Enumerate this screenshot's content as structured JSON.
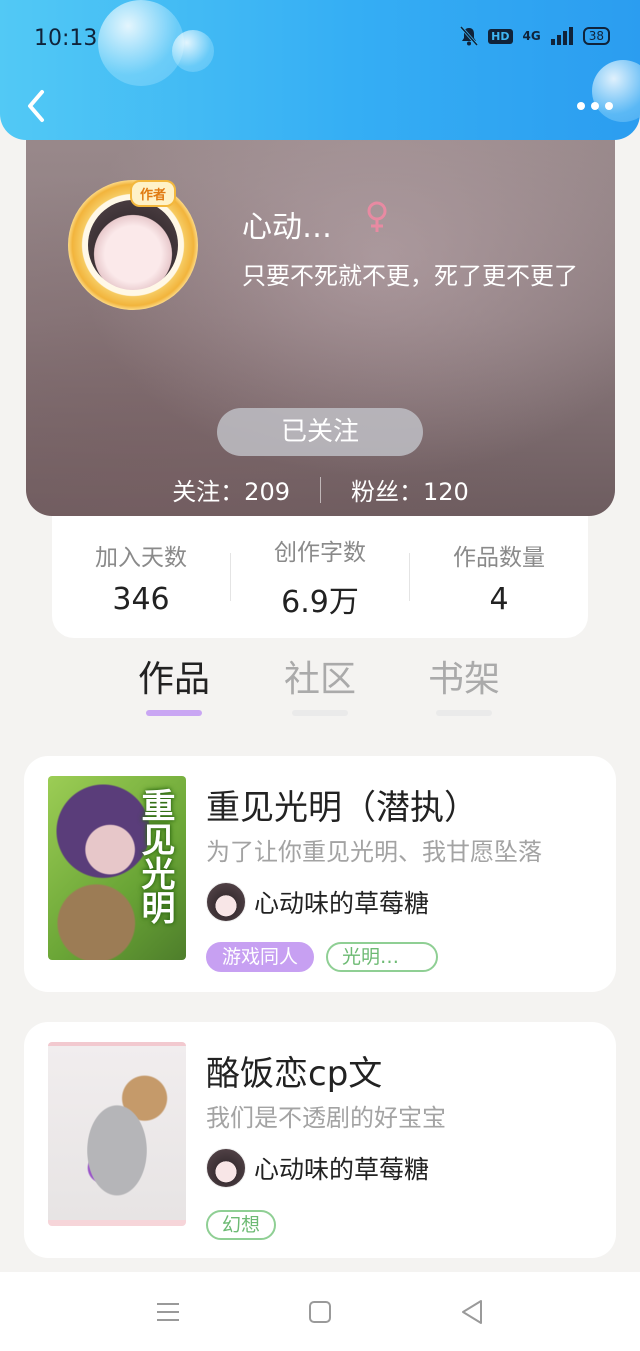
{
  "status_bar": {
    "time": "10:13",
    "hd": "HD",
    "network": "4G",
    "battery": "38"
  },
  "header": {
    "back_icon": "chevron-left-icon",
    "more_icon": "more-dots-icon"
  },
  "profile": {
    "avatar_badge": "作者",
    "name": "心动…",
    "gender_icon": "female-icon",
    "signature": "只要不死就不更，死了更不更了",
    "follow_button": "已关注",
    "following_label": "关注：209",
    "fans_label": "粉丝：120"
  },
  "info": [
    {
      "label": "加入天数",
      "value": "346"
    },
    {
      "label": "创作字数",
      "value": "6.9万"
    },
    {
      "label": "作品数量",
      "value": "4"
    }
  ],
  "tabs": [
    {
      "label": "作品",
      "active": true
    },
    {
      "label": "社区",
      "active": false
    },
    {
      "label": "书架",
      "active": false
    }
  ],
  "works": [
    {
      "title": "重见光明（潜执）",
      "description": "为了让你重见光明、我甘愿坠落",
      "cover_text": "重见光明",
      "author": "心动味的草莓糖",
      "tags": [
        {
          "label": "游戏同人",
          "style": "filled"
        },
        {
          "label": "光明…",
          "style": "outline"
        }
      ]
    },
    {
      "title": "酪饭恋cp文",
      "description": "我们是不透剧的好宝宝",
      "author": "心动味的草莓糖",
      "tags": [
        {
          "label": "幻想",
          "style": "outline"
        }
      ]
    }
  ],
  "colors": {
    "header_gradient_start": "#52c9f5",
    "header_gradient_end": "#2b9df0",
    "tab_indicator": "#c9a6f3",
    "tag_filled": "#c7a0f2",
    "tag_outline": "#8fcf94",
    "gender_icon": "#e88aa2"
  },
  "system_nav": {
    "menu_icon": "menu-icon",
    "home_icon": "home-square-icon",
    "back_icon": "back-triangle-icon"
  }
}
